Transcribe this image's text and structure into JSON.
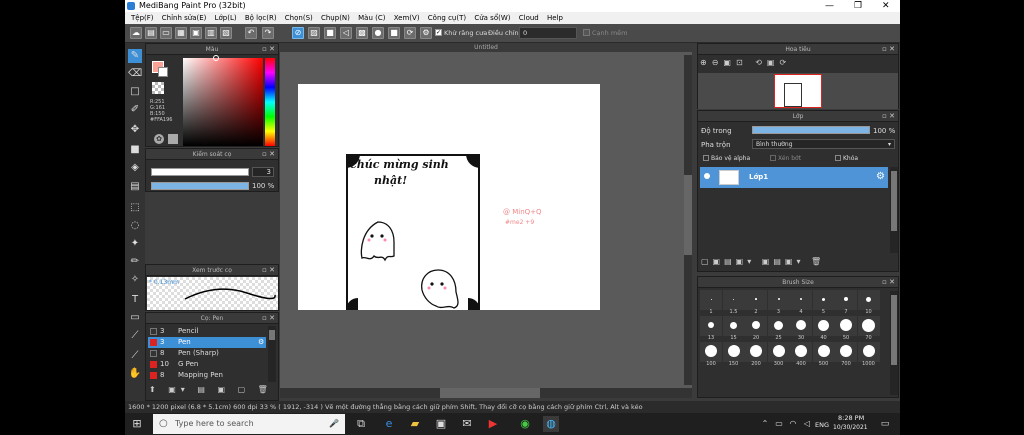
{
  "title": "MediBang Paint Pro (32bit)",
  "window_controls": {
    "minimize": "—",
    "maximize": "❐",
    "close": "✕"
  },
  "menu": [
    "Tệp(F)",
    "Chỉnh sửa(E)",
    "Lớp(L)",
    "Bộ lọc(R)",
    "Chọn(S)",
    "Chụp(N)",
    "Màu (C)",
    "Xem(V)",
    "Công cụ(T)",
    "Cửa sổ(W)",
    "Cloud",
    "Help"
  ],
  "toolbar": {
    "antialias_label": "Khử răng cưa",
    "adjust_label": "Điều chỉnh",
    "adjust_value": "0",
    "edge_label": "Cạnh mềm"
  },
  "color_panel": {
    "title": "Màu",
    "r": "R:251",
    "g": "G:161",
    "b": "B:150",
    "hex": "#FFA196",
    "fg": "#fba196"
  },
  "brush_ctrl": {
    "title": "Kiểm soát cọ",
    "size": "3",
    "opacity": "100 %"
  },
  "preview": {
    "title": "Xem trước cọ",
    "size": "0.13mm"
  },
  "brush_panel": {
    "title": "Cọ: Pen",
    "items": [
      {
        "size": "3",
        "name": "Pencil",
        "active": false
      },
      {
        "size": "3",
        "name": "Pen",
        "active": true
      },
      {
        "size": "8",
        "name": "Pen (Sharp)",
        "active": false
      },
      {
        "size": "10",
        "name": "G Pen",
        "active": false
      },
      {
        "size": "8",
        "name": "Mapping Pen",
        "active": false
      }
    ]
  },
  "canvas": {
    "tab": "Untitled",
    "text1": "chúc mừng sinh",
    "text2": "nhật!",
    "sign1": "@ MinQ+Q",
    "sign2": "#me2 +9"
  },
  "navigator": {
    "title": "Hoa tiêu"
  },
  "layers": {
    "title": "Lớp",
    "opacity_label": "Độ trong",
    "opacity": "100 %",
    "blend_label": "Pha trộn",
    "blend": "Bình thường",
    "protect": "Bảo vệ alpha",
    "clip": "Xén bớt",
    "lock": "Khóa",
    "layer_name": "Lớp1"
  },
  "brush_size": {
    "title": "Brush Size",
    "sizes": [
      "1",
      "1.5",
      "2",
      "3",
      "4",
      "5",
      "7",
      "10",
      "13",
      "15",
      "20",
      "25",
      "30",
      "40",
      "50",
      "70",
      "100",
      "150",
      "200",
      "300",
      "400",
      "500",
      "700",
      "1000"
    ]
  },
  "status": "1600 * 1200 pixel  (6.8 * 5.1cm)  600 dpi  33 %  ( 1912, -314 )  Vẽ một đường thẳng bằng cách giữ phím Shift, Thay đổi cỡ cọ bằng cách giữ phím Ctrl, Alt và kéo",
  "taskbar": {
    "search": "Type here to search",
    "time": "8:28 PM",
    "date": "10/30/2021",
    "lang": "ENG"
  }
}
